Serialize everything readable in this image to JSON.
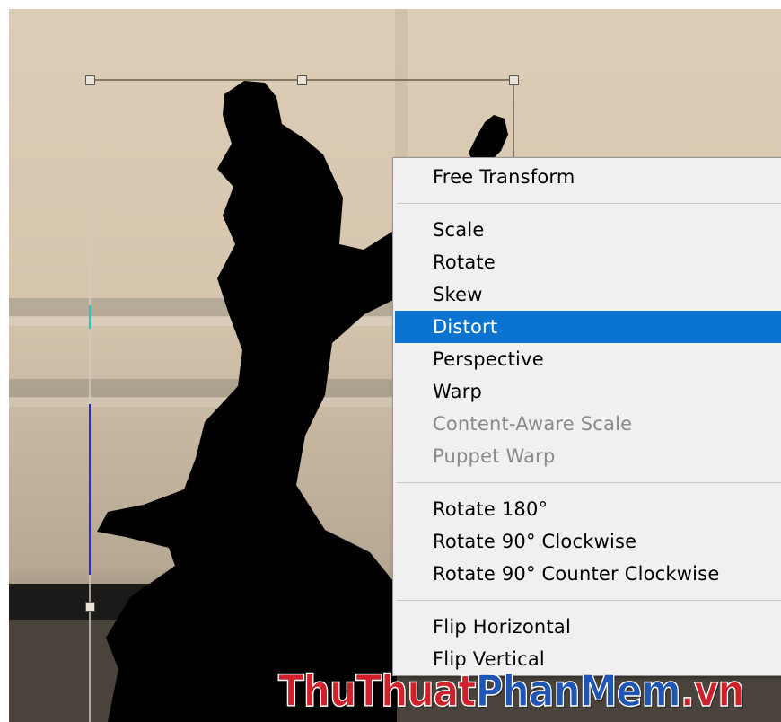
{
  "context_menu": {
    "groups": [
      [
        {
          "label": "Free Transform",
          "enabled": true,
          "selected": false
        }
      ],
      [
        {
          "label": "Scale",
          "enabled": true,
          "selected": false
        },
        {
          "label": "Rotate",
          "enabled": true,
          "selected": false
        },
        {
          "label": "Skew",
          "enabled": true,
          "selected": false
        },
        {
          "label": "Distort",
          "enabled": true,
          "selected": true
        },
        {
          "label": "Perspective",
          "enabled": true,
          "selected": false
        },
        {
          "label": "Warp",
          "enabled": true,
          "selected": false
        },
        {
          "label": "Content-Aware Scale",
          "enabled": false,
          "selected": false
        },
        {
          "label": "Puppet Warp",
          "enabled": false,
          "selected": false
        }
      ],
      [
        {
          "label": "Rotate 180°",
          "enabled": true,
          "selected": false
        },
        {
          "label": "Rotate 90° Clockwise",
          "enabled": true,
          "selected": false
        },
        {
          "label": "Rotate 90° Counter Clockwise",
          "enabled": true,
          "selected": false
        }
      ],
      [
        {
          "label": "Flip Horizontal",
          "enabled": true,
          "selected": false
        },
        {
          "label": "Flip Vertical",
          "enabled": true,
          "selected": false
        }
      ]
    ]
  },
  "watermark": {
    "part1": "ThuThuat",
    "part2": "PhanMem",
    "part3": ".vn"
  },
  "colors": {
    "highlight": "#0a74d0",
    "menu_bg": "#f0f0f0",
    "disabled_text": "#8a8a8a",
    "watermark_red": "#d0202a",
    "watermark_blue": "#1f56b4"
  }
}
